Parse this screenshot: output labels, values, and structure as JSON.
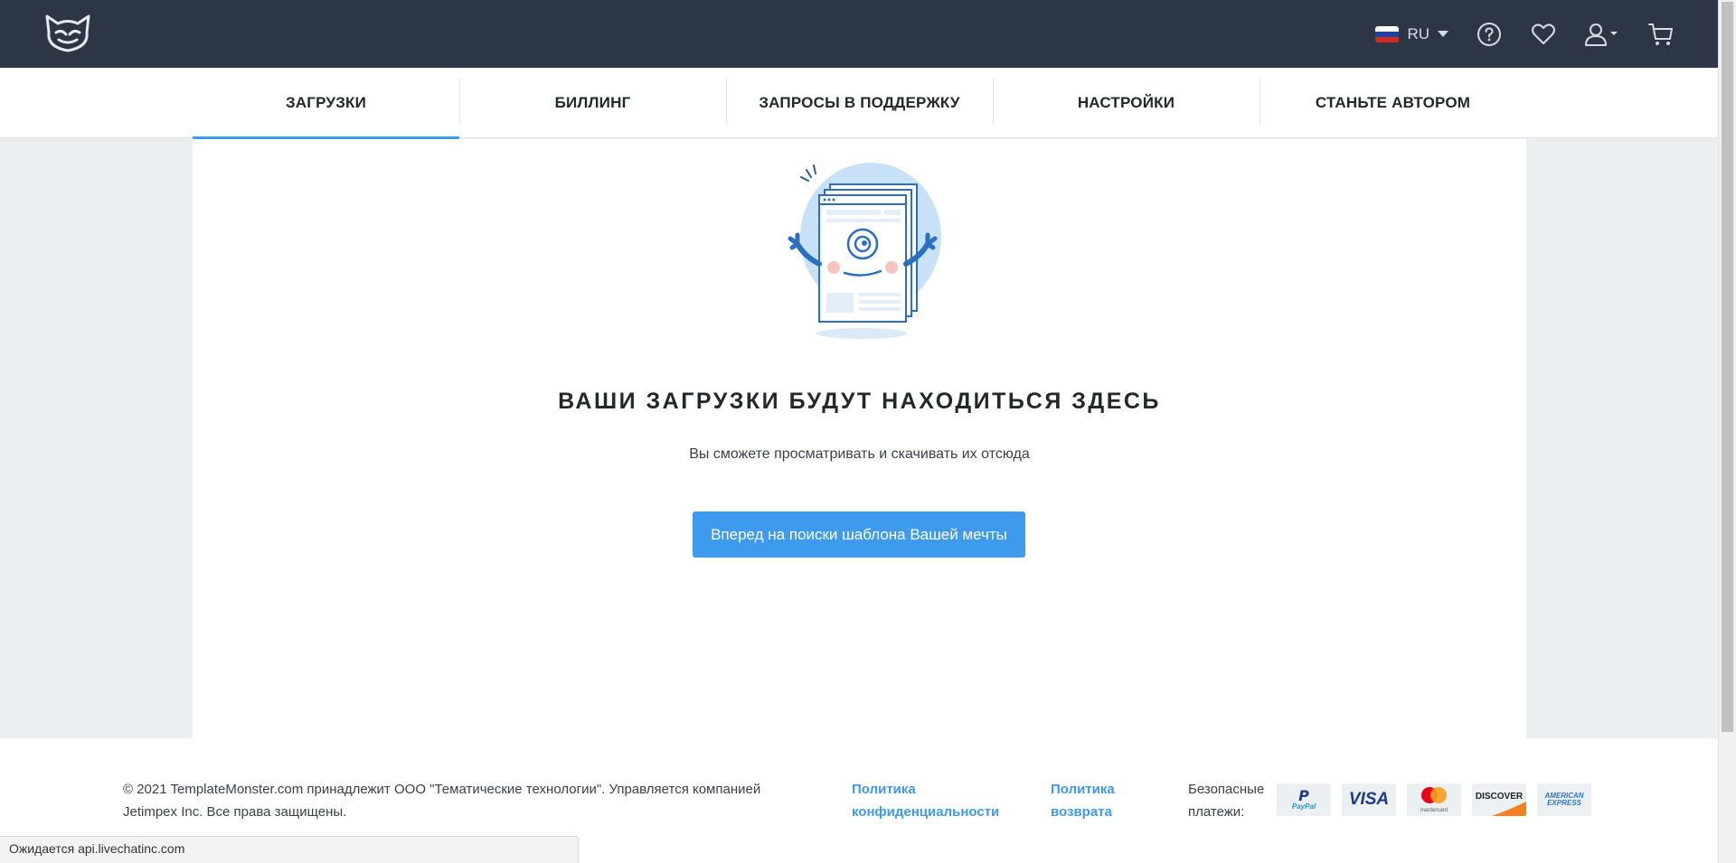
{
  "header": {
    "language": "RU",
    "colors": {
      "background": "#2d3645",
      "icon": "#d7dce3"
    },
    "icons": [
      "help-icon",
      "heart-icon",
      "user-icon",
      "cart-icon"
    ]
  },
  "tabs": [
    {
      "label": "ЗАГРУЗКИ",
      "active": true
    },
    {
      "label": "БИЛЛИНГ",
      "active": false
    },
    {
      "label": "ЗАПРОСЫ В ПОДДЕРЖКУ",
      "active": false
    },
    {
      "label": "НАСТРОЙКИ",
      "active": false
    },
    {
      "label": "СТАНЬТЕ АВТОРОМ",
      "active": false
    }
  ],
  "empty_state": {
    "title": "ВАШИ ЗАГРУЗКИ БУДУТ НАХОДИТЬСЯ ЗДЕСЬ",
    "subtitle": "Вы сможете просматривать и скачивать их отсюда",
    "cta_label": "Вперед на поиски шаблона Вашей мечты"
  },
  "footer": {
    "copyright": "© 2021 TemplateMonster.com принадлежит ООО \"Тематические технологии\". Управляется компанией Jetimpex Inc. Все права защищены.",
    "privacy_link": "Политика конфиденциальности",
    "refund_link": "Политика возврата",
    "payments_label": "Безопасные платежи:",
    "payment_methods": {
      "paypal": "PayPal",
      "visa": "VISA",
      "mastercard": "mastercard",
      "discover": "DISCOVER",
      "amex_line1": "AMERICAN",
      "amex_line2": "EXPRESS"
    }
  },
  "status_bar": "Ожидается api.livechatinc.com",
  "colors": {
    "accent": "#3d9aec",
    "page_bg": "#eceff2"
  }
}
